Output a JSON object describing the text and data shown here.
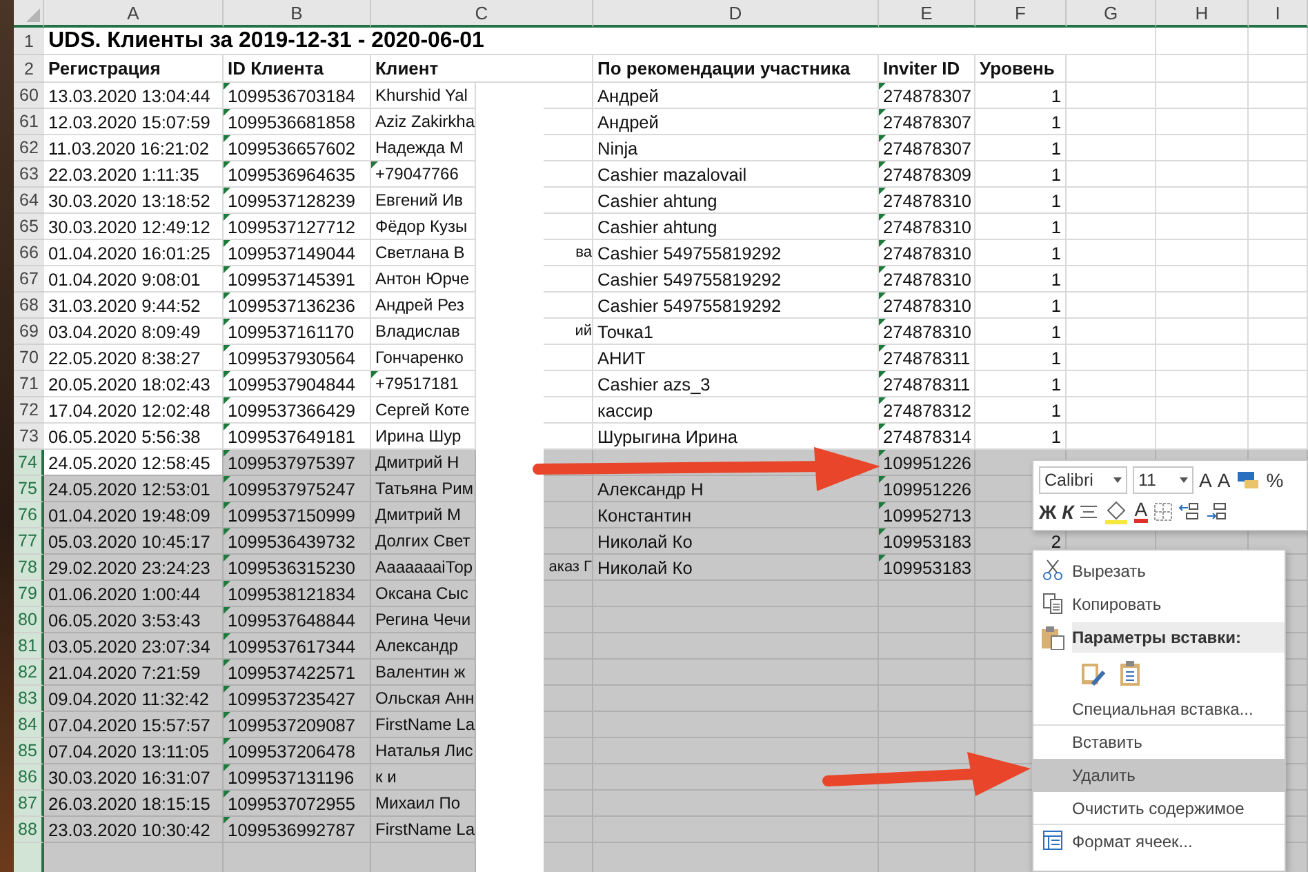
{
  "columns": [
    "A",
    "B",
    "C",
    "D",
    "E",
    "F",
    "G",
    "H",
    "I"
  ],
  "title_row": {
    "number": "1",
    "text": "UDS. Клиенты за 2019-12-31 - 2020-06-01"
  },
  "header_row": {
    "number": "2",
    "cells": [
      "Регистрация",
      "ID Клиента",
      "Клиент",
      "По рекомендации участника",
      "Inviter ID",
      "Уровень"
    ]
  },
  "rows": [
    {
      "number": "60",
      "selected": false,
      "active": false,
      "registered": "13.03.2020 13:04:44",
      "client_id": "1099536703184",
      "client": "Khurshid Yal",
      "client_flagged": false,
      "referrer": "Андрей",
      "inviter_id": "274878307",
      "level": "1"
    },
    {
      "number": "61",
      "selected": false,
      "active": false,
      "registered": "12.03.2020 15:07:59",
      "client_id": "1099536681858",
      "client": "Aziz Zakirkha",
      "client_flagged": false,
      "referrer": "Андрей",
      "inviter_id": "274878307",
      "level": "1"
    },
    {
      "number": "62",
      "selected": false,
      "active": false,
      "registered": "11.03.2020 16:21:02",
      "client_id": "1099536657602",
      "client": "Надежда М",
      "client_flagged": false,
      "referrer": "Ninja",
      "inviter_id": "274878307",
      "level": "1"
    },
    {
      "number": "63",
      "selected": false,
      "active": false,
      "registered": "22.03.2020 1:11:35",
      "client_id": "1099536964635",
      "client": "+79047766",
      "client_flagged": true,
      "referrer": "Cashier mazalovail",
      "inviter_id": "274878309",
      "level": "1"
    },
    {
      "number": "64",
      "selected": false,
      "active": false,
      "registered": "30.03.2020 13:18:52",
      "client_id": "1099537128239",
      "client": "Евгений Ив",
      "client_flagged": false,
      "referrer": "Cashier ahtung",
      "inviter_id": "274878310",
      "level": "1"
    },
    {
      "number": "65",
      "selected": false,
      "active": false,
      "registered": "30.03.2020 12:49:12",
      "client_id": "1099537127712",
      "client": "Фёдор Кузы",
      "client_flagged": false,
      "referrer": "Cashier ahtung",
      "inviter_id": "274878310",
      "level": "1"
    },
    {
      "number": "66",
      "selected": false,
      "active": false,
      "registered": "01.04.2020 16:01:25",
      "client_id": "1099537149044",
      "client": "Светлана В",
      "client_tail": "ва",
      "client_flagged": false,
      "referrer": "Cashier 549755819292",
      "inviter_id": "274878310",
      "level": "1"
    },
    {
      "number": "67",
      "selected": false,
      "active": false,
      "registered": "01.04.2020 9:08:01",
      "client_id": "1099537145391",
      "client": "Антон Юрче",
      "client_flagged": false,
      "referrer": "Cashier 549755819292",
      "inviter_id": "274878310",
      "level": "1"
    },
    {
      "number": "68",
      "selected": false,
      "active": false,
      "registered": "31.03.2020 9:44:52",
      "client_id": "1099537136236",
      "client": "Андрей Рез",
      "client_flagged": false,
      "referrer": "Cashier 549755819292",
      "inviter_id": "274878310",
      "level": "1"
    },
    {
      "number": "69",
      "selected": false,
      "active": false,
      "registered": "03.04.2020 8:09:49",
      "client_id": "1099537161170",
      "client": "Владислав",
      "client_tail": "ий",
      "client_flagged": false,
      "referrer": "Точка1",
      "inviter_id": "274878310",
      "level": "1"
    },
    {
      "number": "70",
      "selected": false,
      "active": false,
      "registered": "22.05.2020 8:38:27",
      "client_id": "1099537930564",
      "client": "Гончаренко",
      "client_flagged": false,
      "referrer": "АНИТ",
      "inviter_id": "274878311",
      "level": "1"
    },
    {
      "number": "71",
      "selected": false,
      "active": false,
      "registered": "20.05.2020 18:02:43",
      "client_id": "1099537904844",
      "client": "+79517181",
      "client_flagged": true,
      "referrer": "Cashier azs_3",
      "inviter_id": "274878311",
      "level": "1"
    },
    {
      "number": "72",
      "selected": false,
      "active": false,
      "registered": "17.04.2020 12:02:48",
      "client_id": "1099537366429",
      "client": "Сергей Коте",
      "client_flagged": false,
      "referrer": "кассир",
      "inviter_id": "274878312",
      "level": "1"
    },
    {
      "number": "73",
      "selected": false,
      "active": false,
      "registered": "06.05.2020 5:56:38",
      "client_id": "1099537649181",
      "client": "Ирина Шур",
      "client_flagged": false,
      "referrer": "Шурыгина Ирина",
      "inviter_id": "274878314",
      "level": "1"
    },
    {
      "number": "74",
      "selected": true,
      "active": true,
      "registered": "24.05.2020 12:58:45",
      "client_id": "1099537975397",
      "client": "Дмитрий Н",
      "client_flagged": false,
      "inviter_id": "109951226"
    },
    {
      "number": "75",
      "selected": true,
      "active": false,
      "registered": "24.05.2020 12:53:01",
      "client_id": "1099537975247",
      "client": "Татьяна Рим",
      "client_flagged": false,
      "referrer": "Александр Н",
      "inviter_id": "109951226"
    },
    {
      "number": "76",
      "selected": true,
      "active": false,
      "registered": "01.04.2020 19:48:09",
      "client_id": "1099537150999",
      "client": "Дмитрий М",
      "client_flagged": false,
      "referrer": "Константин",
      "inviter_id": "109952713"
    },
    {
      "number": "77",
      "selected": true,
      "active": false,
      "registered": "05.03.2020 10:45:17",
      "client_id": "1099536439732",
      "client": "Долгих Свет",
      "client_flagged": false,
      "referrer": "Николай Ко",
      "inviter_id": "109953183",
      "level": "2"
    },
    {
      "number": "78",
      "selected": true,
      "active": false,
      "registered": "29.02.2020 23:24:23",
      "client_id": "1099536315230",
      "client": "АааааааіТор",
      "client_tail": "аказ Г",
      "client_flagged": false,
      "referrer": "Николай Ко",
      "inviter_id": "109953183"
    },
    {
      "number": "79",
      "selected": true,
      "active": false,
      "registered": "01.06.2020 1:00:44",
      "client_id": "1099538121834",
      "client": "Оксана Сыс",
      "client_flagged": false
    },
    {
      "number": "80",
      "selected": true,
      "active": false,
      "registered": "06.05.2020 3:53:43",
      "client_id": "1099537648844",
      "client": "Регина Чечи",
      "client_flagged": false
    },
    {
      "number": "81",
      "selected": true,
      "active": false,
      "registered": "03.05.2020 23:07:34",
      "client_id": "1099537617344",
      "client": "Александр",
      "client_flagged": false
    },
    {
      "number": "82",
      "selected": true,
      "active": false,
      "registered": "21.04.2020 7:21:59",
      "client_id": "1099537422571",
      "client": "Валентин ж",
      "client_flagged": false
    },
    {
      "number": "83",
      "selected": true,
      "active": false,
      "registered": "09.04.2020 11:32:42",
      "client_id": "1099537235427",
      "client": "Ольская Анн",
      "client_flagged": false
    },
    {
      "number": "84",
      "selected": true,
      "active": false,
      "registered": "07.04.2020 15:57:57",
      "client_id": "1099537209087",
      "client": "FirstName La",
      "client_flagged": false
    },
    {
      "number": "85",
      "selected": true,
      "active": false,
      "registered": "07.04.2020 13:11:05",
      "client_id": "1099537206478",
      "client": "Наталья Лис",
      "client_flagged": false
    },
    {
      "number": "86",
      "selected": true,
      "active": false,
      "registered": "30.03.2020 16:31:07",
      "client_id": "1099537131196",
      "client": "к и",
      "client_flagged": false
    },
    {
      "number": "87",
      "selected": true,
      "active": false,
      "registered": "26.03.2020 18:15:15",
      "client_id": "1099537072955",
      "client": "Михаил По",
      "client_flagged": false
    },
    {
      "number": "88",
      "selected": true,
      "active": false,
      "registered": "23.03.2020 10:30:42",
      "client_id": "1099536992787",
      "client": "FirstName La",
      "client_flagged": false
    }
  ],
  "mini_toolbar": {
    "font": "Calibri",
    "size": "11",
    "grow": "A",
    "shrink": "A",
    "percent": "%",
    "bold": "Ж",
    "italic": "К",
    "font_color": "A"
  },
  "context_menu": [
    {
      "kind": "cut",
      "label": "Вырезать",
      "selected": false,
      "separator": false
    },
    {
      "kind": "copy",
      "label": "Копировать",
      "selected": false,
      "separator": false
    },
    {
      "kind": "paste-header",
      "label": "Параметры вставки:"
    },
    {
      "kind": "paste-options"
    },
    {
      "kind": "plain",
      "label": "Специальная вставка...",
      "selected": false,
      "separator": true
    },
    {
      "kind": "plain",
      "label": "Вставить",
      "selected": false,
      "separator": false
    },
    {
      "kind": "plain",
      "label": "Удалить",
      "selected": true,
      "separator": false
    },
    {
      "kind": "plain",
      "label": "Очистить содержимое",
      "selected": false,
      "separator": true
    },
    {
      "kind": "format",
      "label": "Формат ячеек...",
      "selected": false,
      "separator": false
    }
  ]
}
